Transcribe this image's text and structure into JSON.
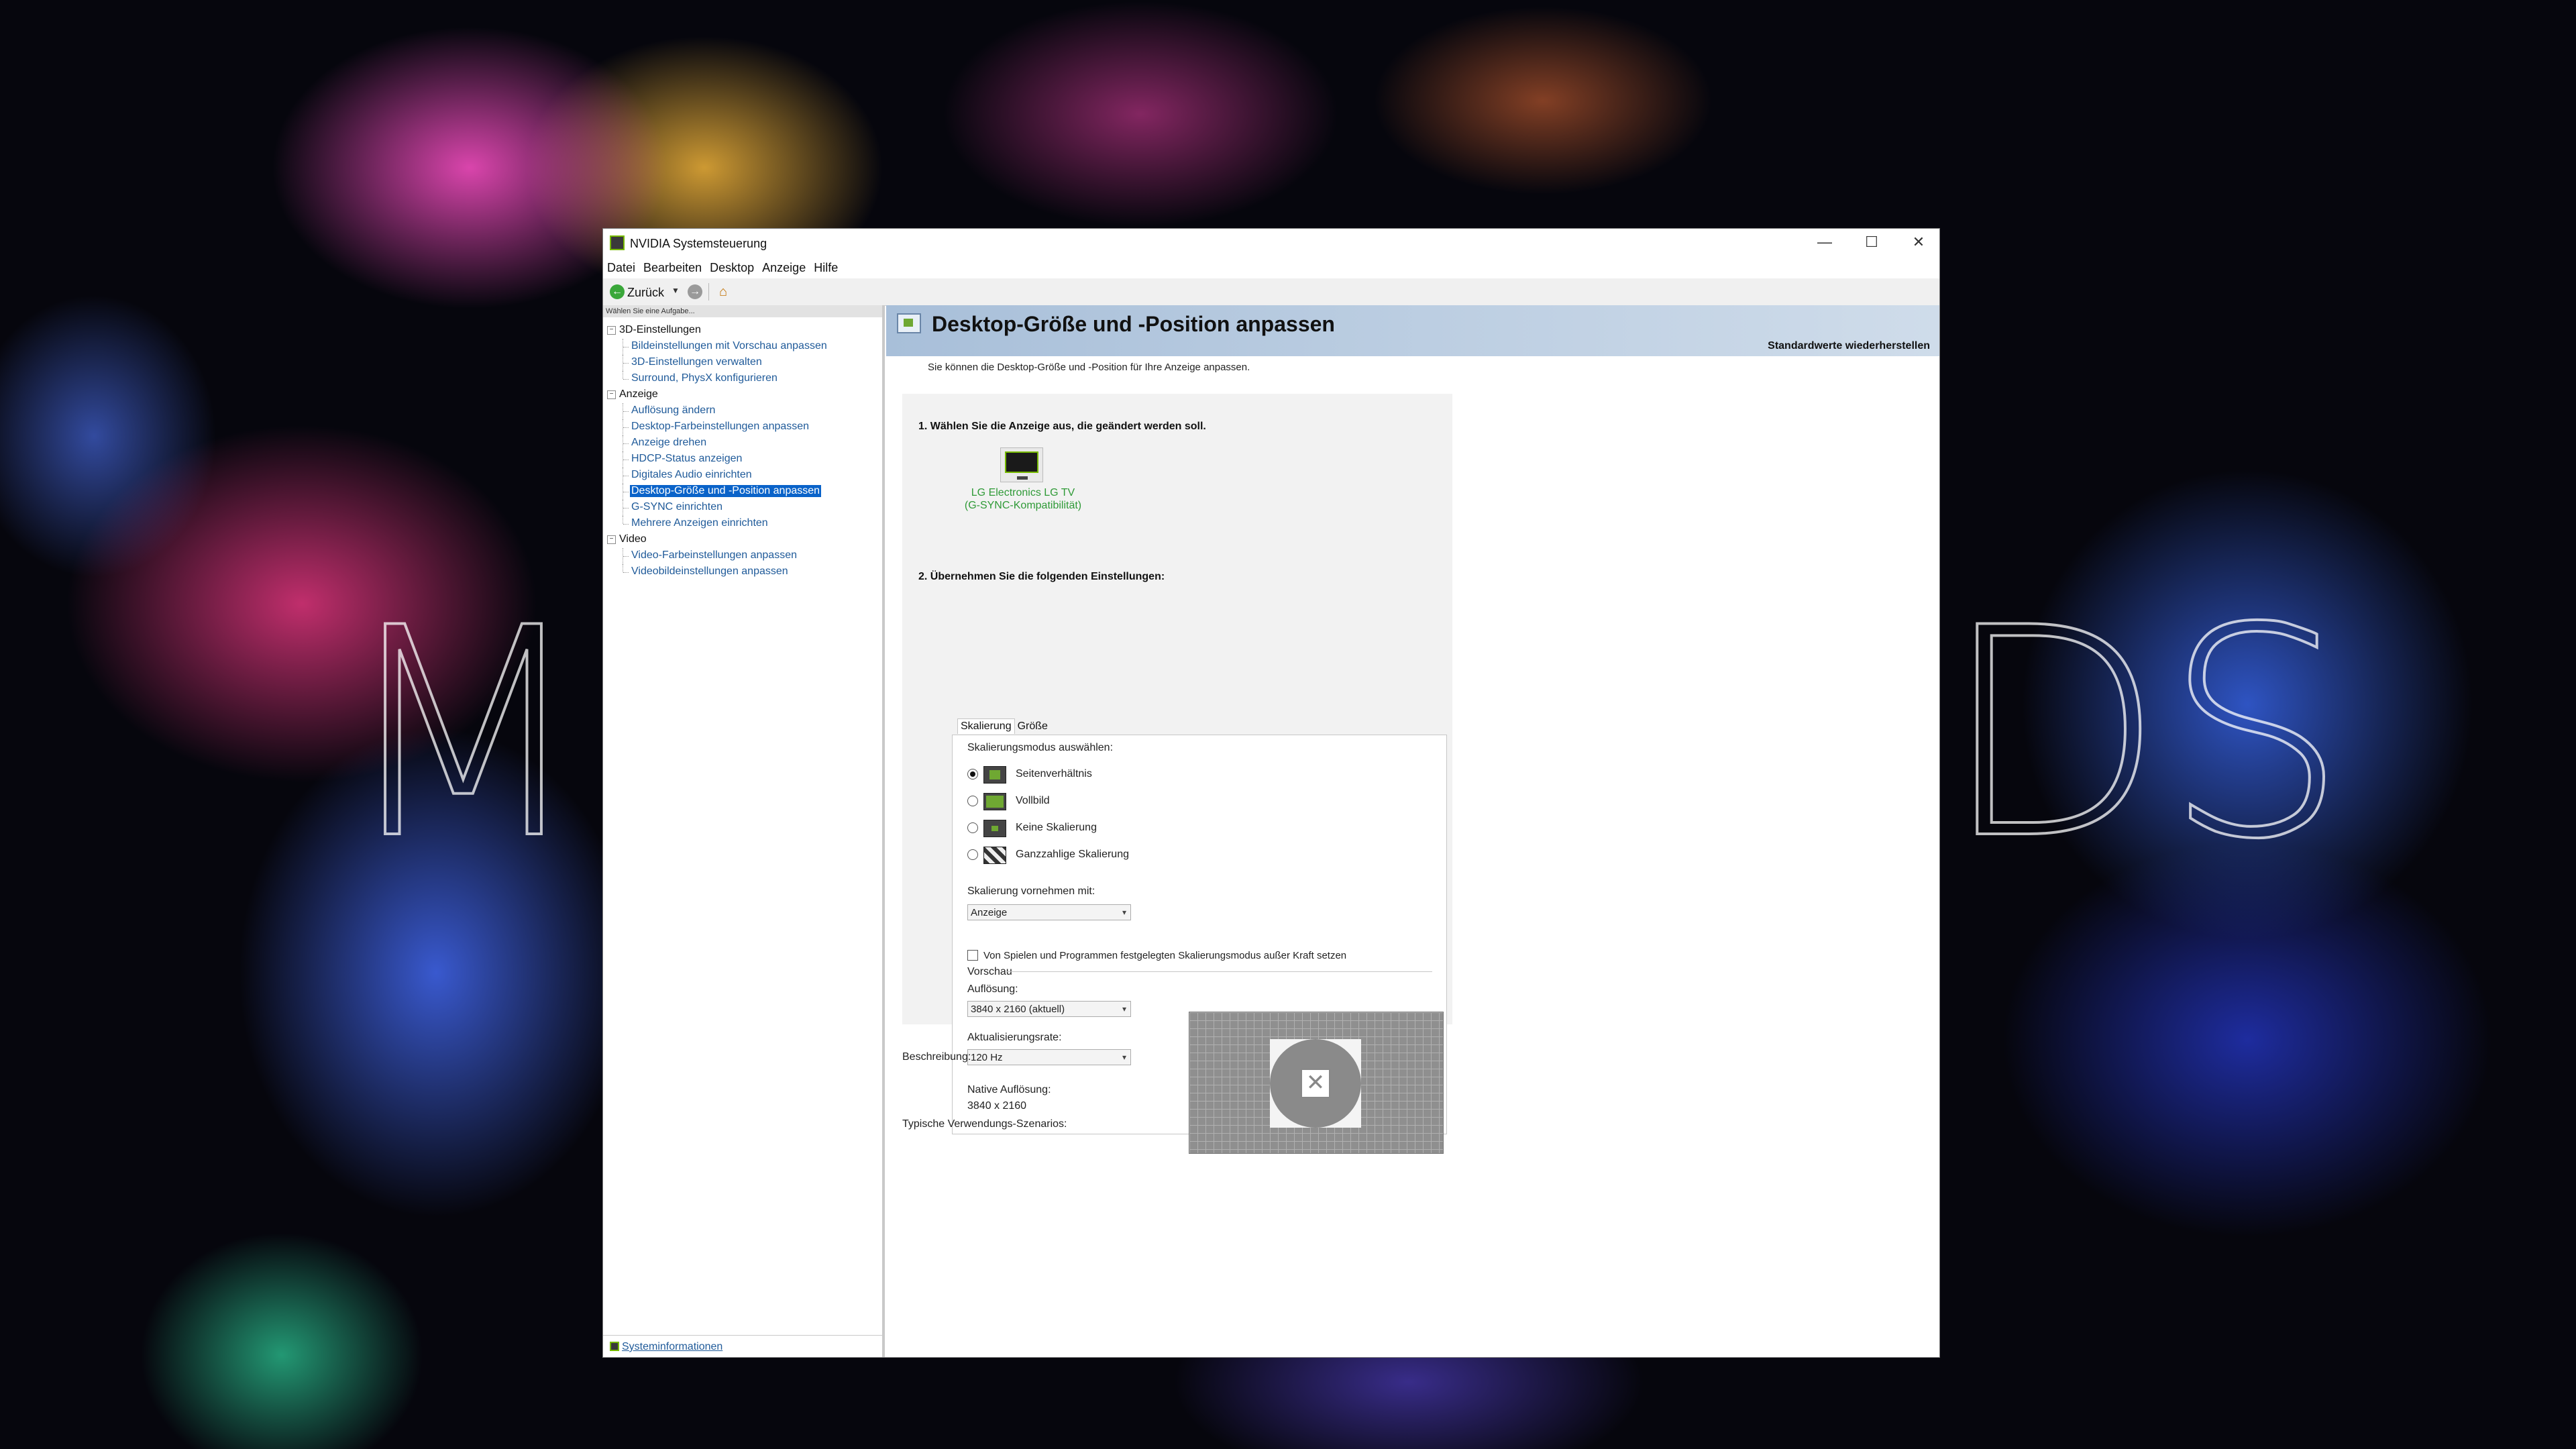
{
  "background": {
    "left_text": "M",
    "right_text": "DS"
  },
  "window": {
    "title": "NVIDIA Systemsteuerung",
    "controls": {
      "minimize": "—",
      "maximize": "☐",
      "close": "✕"
    }
  },
  "menubar": {
    "items": [
      "Datei",
      "Bearbeiten",
      "Desktop",
      "Anzeige",
      "Hilfe"
    ]
  },
  "toolbar": {
    "back_label": "Zurück"
  },
  "sidebar": {
    "task_header": "Wählen Sie eine Aufgabe...",
    "categories": [
      {
        "label": "3D-Einstellungen",
        "items": [
          "Bildeinstellungen mit Vorschau anpassen",
          "3D-Einstellungen verwalten",
          "Surround, PhysX konfigurieren"
        ]
      },
      {
        "label": "Anzeige",
        "items": [
          "Auflösung ändern",
          "Desktop-Farbeinstellungen anpassen",
          "Anzeige drehen",
          "HDCP-Status anzeigen",
          "Digitales Audio einrichten",
          "Desktop-Größe und -Position anpassen",
          "G-SYNC einrichten",
          "Mehrere Anzeigen einrichten"
        ]
      },
      {
        "label": "Video",
        "items": [
          "Video-Farbeinstellungen anpassen",
          "Videobildeinstellungen anpassen"
        ]
      }
    ],
    "selected_item": "Desktop-Größe und -Position anpassen",
    "system_info_link": "Systeminformationen"
  },
  "page": {
    "title": "Desktop-Größe und -Position anpassen",
    "restore_defaults": "Standardwerte wiederherstellen",
    "description": "Sie können die Desktop-Größe und -Position für Ihre Anzeige anpassen.",
    "step1": "1. Wählen Sie die Anzeige aus, die geändert werden soll.",
    "display_name_line1": "LG Electronics LG TV",
    "display_name_line2": "(G-SYNC-Kompatibilität)",
    "step2": "2. Übernehmen Sie die folgenden Einstellungen:",
    "tabs": [
      "Skalierung",
      "Größe"
    ],
    "scaling_mode_label": "Skalierungsmodus auswählen:",
    "scaling_options": [
      "Seitenverhältnis",
      "Vollbild",
      "Keine Skalierung",
      "Ganzzahlige Skalierung"
    ],
    "selected_scaling": "Seitenverhältnis",
    "perform_scaling_label": "Skalierung vornehmen mit:",
    "perform_scaling_value": "Anzeige",
    "override_checkbox_label": "Von Spielen und Programmen festgelegten Skalierungsmodus außer Kraft setzen",
    "override_checked": false,
    "preview_label": "Vorschau",
    "resolution_label": "Auflösung:",
    "resolution_value": "3840 x 2160 (aktuell)",
    "refresh_label": "Aktualisierungsrate:",
    "refresh_value": "120 Hz",
    "native_label": "Native Auflösung:",
    "native_value": "3840 x 2160",
    "description_label": "Beschreibung:",
    "scenarios_label": "Typische Verwendungs-Szenarios:"
  }
}
